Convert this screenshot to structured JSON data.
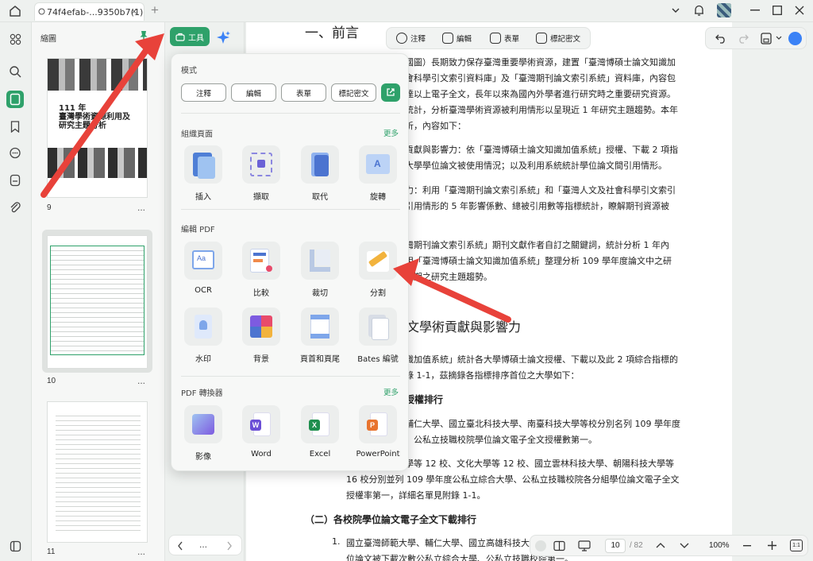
{
  "titlebar": {
    "tab_label": "74f4efab-...9350b7(1)",
    "tab_close": "×",
    "add_tab": "+"
  },
  "thumbs": {
    "title": "縮圖",
    "pages": [
      {
        "num": "9",
        "cover_line1": "111 年",
        "cover_line2": "臺灣學術資源利用及",
        "cover_line3": "研究主題分析"
      },
      {
        "num": "10"
      },
      {
        "num": "11"
      }
    ],
    "more": "..."
  },
  "toolbar": {
    "tools_label": "工具",
    "annotate": "注釋",
    "edit": "編輯",
    "form": "表單",
    "redact": "標記密文"
  },
  "popup": {
    "mode_title": "模式",
    "modes": [
      "注釋",
      "編輯",
      "表單",
      "標記密文"
    ],
    "organize_title": "組織頁面",
    "organize_more": "更多",
    "organize_tools": [
      "插入",
      "擷取",
      "取代",
      "旋轉"
    ],
    "edit_title": "編輯 PDF",
    "edit_tools": [
      "OCR",
      "比較",
      "裁切",
      "分割",
      "水印",
      "背景",
      "頁首和頁尾",
      "Bates 編號"
    ],
    "convert_title": "PDF 轉換器",
    "convert_more": "更多",
    "convert_tools": [
      "影像",
      "Word",
      "Excel",
      "PowerPoint"
    ]
  },
  "document": {
    "h1": "一、前言",
    "lines": [
      "國圖）長期致力保存臺灣重要學術資源，建置「臺灣博碩士論文知識加",
      "會科學引文索引資料庫」及「臺灣期刊論文索引系統」資料庫，內容包",
      "達以上電子全文，長年以來為國內外學者進行研究時之重要研究資源。",
      "統計，分析臺灣學術資源被利用情形以呈現近 1 年研究主題趨勢。本年",
      "析，內容如下：",
      "貢獻與影響力：依「臺灣博碩士論文知識加值系統」授權、下載 2 項指",
      "大學學位論文被使用情況；以及利用系統統計學位論文間引用情形。",
      "力：利用「臺灣期刊論文索引系統」和「臺灣人文及社會科學引文索引",
      "引用情形的 5 年影響係數、總被引用數等指標統計，瞭解期刊資源被",
      "灣期刊論文索引系統」期刊文獻作者自訂之關鍵詞，統計分析 1 年內",
      "用「臺灣博碩士論文知識加值系統」整理分析 109 學年度論文中之研",
      "近期之研究主題趨勢。"
    ],
    "h2": "文學術貢獻與影響力",
    "lines2": [
      "識加值系統」統計各大學博碩士論文授權、下載以及此 2 項綜合指標的",
      "錄 1-1，茲摘錄各指標排序首位之大學如下：",
      "授權排行",
      "輔仁大學、國立臺北科技大學、南臺科技大學等校分別名列 109 學年度",
      "、公私立技職校院學位論文電子全文授權數第一。",
      "學等 12 校、文化大學等 12 校、國立雲林科技大學、朝陽科技大學等",
      "16 校分別並列 109 學年度公私立綜合大學、公私立技職校院各分組學位論文電子全文",
      "授權率第一，詳細名單見附錄 1-1。",
      "（二）各校院學位論文電子全文下載排行",
      "1.",
      "國立臺灣師範大學、輔仁大學、國立高雄科技大學",
      "位論文被下載次數公私立綜合大學、公私立技職校院第一。"
    ]
  },
  "zoombar": {
    "page_current": "10",
    "page_total": "/ 82",
    "zoom": "100%"
  },
  "colors": {
    "accent": "#2ea16a",
    "arrow": "#e8423a"
  }
}
